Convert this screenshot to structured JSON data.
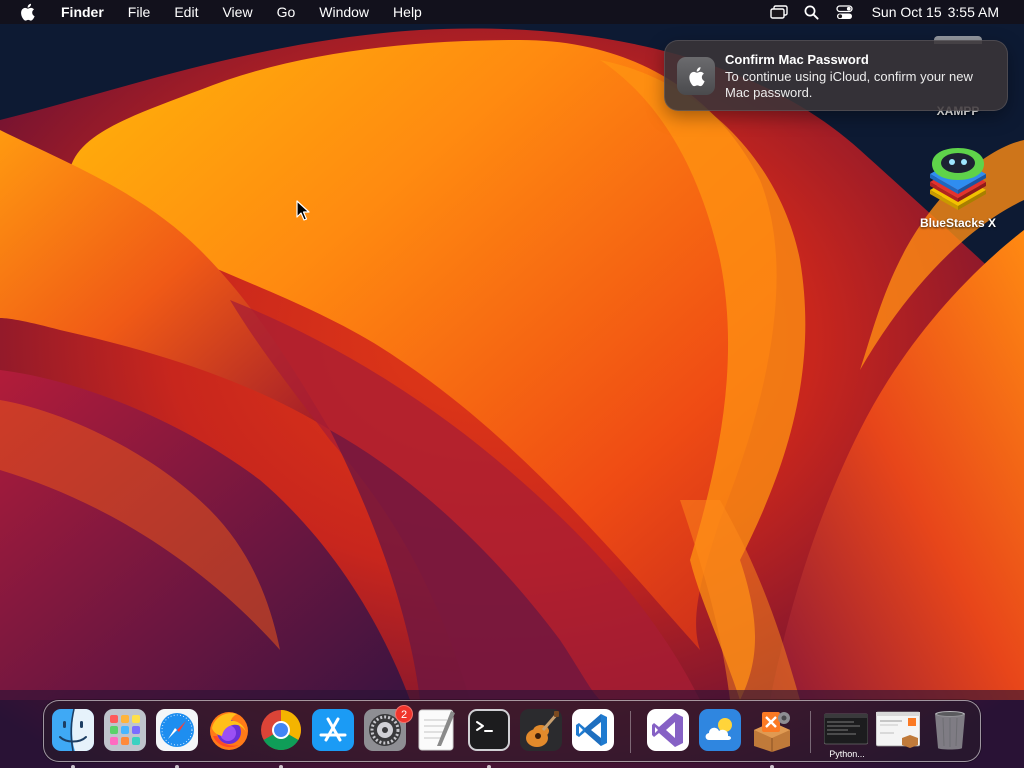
{
  "menubar": {
    "apple_icon": "apple-logo-icon",
    "app_name": "Finder",
    "menus": [
      "File",
      "Edit",
      "View",
      "Go",
      "Window",
      "Help"
    ],
    "status_icons": [
      "screen-mirroring-icon",
      "spotlight-search-icon",
      "control-center-icon"
    ],
    "date": "Sun Oct 15",
    "time": "3:55 AM"
  },
  "notification": {
    "app_icon": "apple-logo-icon",
    "title": "Confirm Mac Password",
    "body": "To continue using iCloud, confirm your new Mac password."
  },
  "desktop": {
    "icons": [
      {
        "label": "XAMPP",
        "icon": "xampp-drive-icon"
      },
      {
        "label": "BlueStacks X",
        "icon": "bluestacks-icon"
      }
    ]
  },
  "dock": {
    "apps": [
      {
        "name": "Finder",
        "icon": "finder-icon",
        "running": true
      },
      {
        "name": "Launchpad",
        "icon": "launchpad-icon",
        "running": false
      },
      {
        "name": "Safari",
        "icon": "safari-icon",
        "running": true
      },
      {
        "name": "Firefox",
        "icon": "firefox-icon",
        "running": false
      },
      {
        "name": "Google Chrome",
        "icon": "chrome-icon",
        "running": true
      },
      {
        "name": "App Store",
        "icon": "app-store-icon",
        "running": false
      },
      {
        "name": "System Settings",
        "icon": "system-settings-icon",
        "running": false,
        "badge": "2"
      },
      {
        "name": "TextEdit",
        "icon": "textedit-icon",
        "running": false
      },
      {
        "name": "Terminal",
        "icon": "terminal-icon",
        "running": true
      },
      {
        "name": "GarageBand",
        "icon": "garageband-icon",
        "running": false
      },
      {
        "name": "Visual Studio Code",
        "icon": "vscode-icon",
        "running": false
      }
    ],
    "recent_apps": [
      {
        "name": "Visual Studio",
        "icon": "visual-studio-icon",
        "running": false
      },
      {
        "name": "Weather",
        "icon": "weather-icon",
        "running": false
      },
      {
        "name": "XAMPP Manager",
        "icon": "xampp-manager-icon",
        "running": true
      }
    ],
    "minimized": [
      {
        "label": "Python...",
        "icon": "terminal-window-thumbnail-icon"
      },
      {
        "label": "",
        "icon": "xampp-window-thumbnail-icon"
      }
    ],
    "trash": {
      "icon": "trash-icon"
    }
  },
  "colors": {
    "menubar_bg": "#141016",
    "badge": "#f0342c",
    "accent_orange": "#ff7a1a",
    "deep_red": "#c21f2a",
    "wallpaper_navy": "#0d1a33"
  }
}
